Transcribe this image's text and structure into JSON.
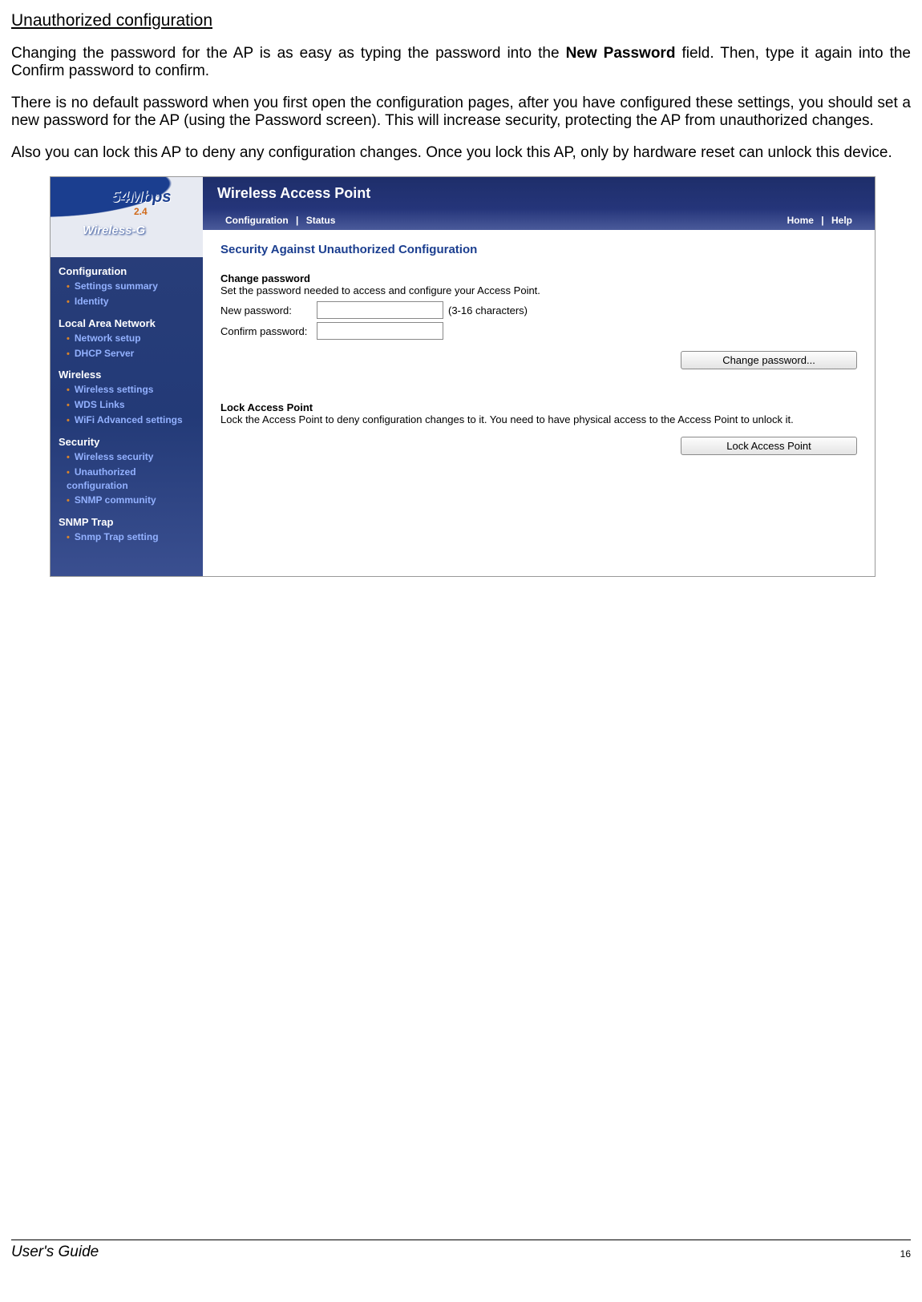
{
  "heading": "Unauthorized configuration",
  "para1_a": "Changing the password for the AP is as easy as typing the password into the ",
  "para1_bold": "New Password",
  "para1_b": " field. Then, type it again into the Confirm password to confirm.",
  "para2": "There is no default password when you first open the configuration pages, after you have configured these settings, you should set a new password for the AP (using the Password screen). This will increase security, protecting the AP from unauthorized changes.",
  "para3": "Also you can lock this AP to deny any configuration changes. Once you lock this AP, only by hardware reset can unlock this device.",
  "logo": {
    "rate": "54Mbps",
    "band": "2.4",
    "brand": "Wireless-G"
  },
  "banner": {
    "title": "Wireless Access Point",
    "left_primary": "Configuration",
    "left_secondary": "Status",
    "right_primary": "Home",
    "right_secondary": "Help",
    "sep": "|"
  },
  "sidebar": {
    "groups": [
      {
        "title": "Configuration",
        "items": [
          "Settings summary",
          "Identity"
        ]
      },
      {
        "title": "Local Area Network",
        "items": [
          "Network setup",
          "DHCP Server"
        ]
      },
      {
        "title": "Wireless",
        "items": [
          "Wireless settings",
          "WDS Links",
          "WiFi Advanced settings"
        ]
      },
      {
        "title": "Security",
        "items": [
          "Wireless security",
          "Unauthorized configuration",
          "SNMP community"
        ]
      },
      {
        "title": "SNMP Trap",
        "items": [
          "Snmp Trap setting"
        ]
      }
    ]
  },
  "panel": {
    "title": "Security Against Unauthorized Configuration",
    "change_pw_title": "Change password",
    "change_pw_desc": "Set the password needed to access and configure your Access Point.",
    "new_pw_label": "New password:",
    "confirm_pw_label": "Confirm password:",
    "hint": "(3-16 characters)",
    "change_pw_btn": "Change password...",
    "lock_title": "Lock Access Point",
    "lock_desc": "Lock the Access Point to deny configuration changes to it. You need to have physical access to the Access Point to unlock it.",
    "lock_btn": "Lock Access Point"
  },
  "footer": {
    "guide": "User's Guide",
    "page": "16"
  }
}
